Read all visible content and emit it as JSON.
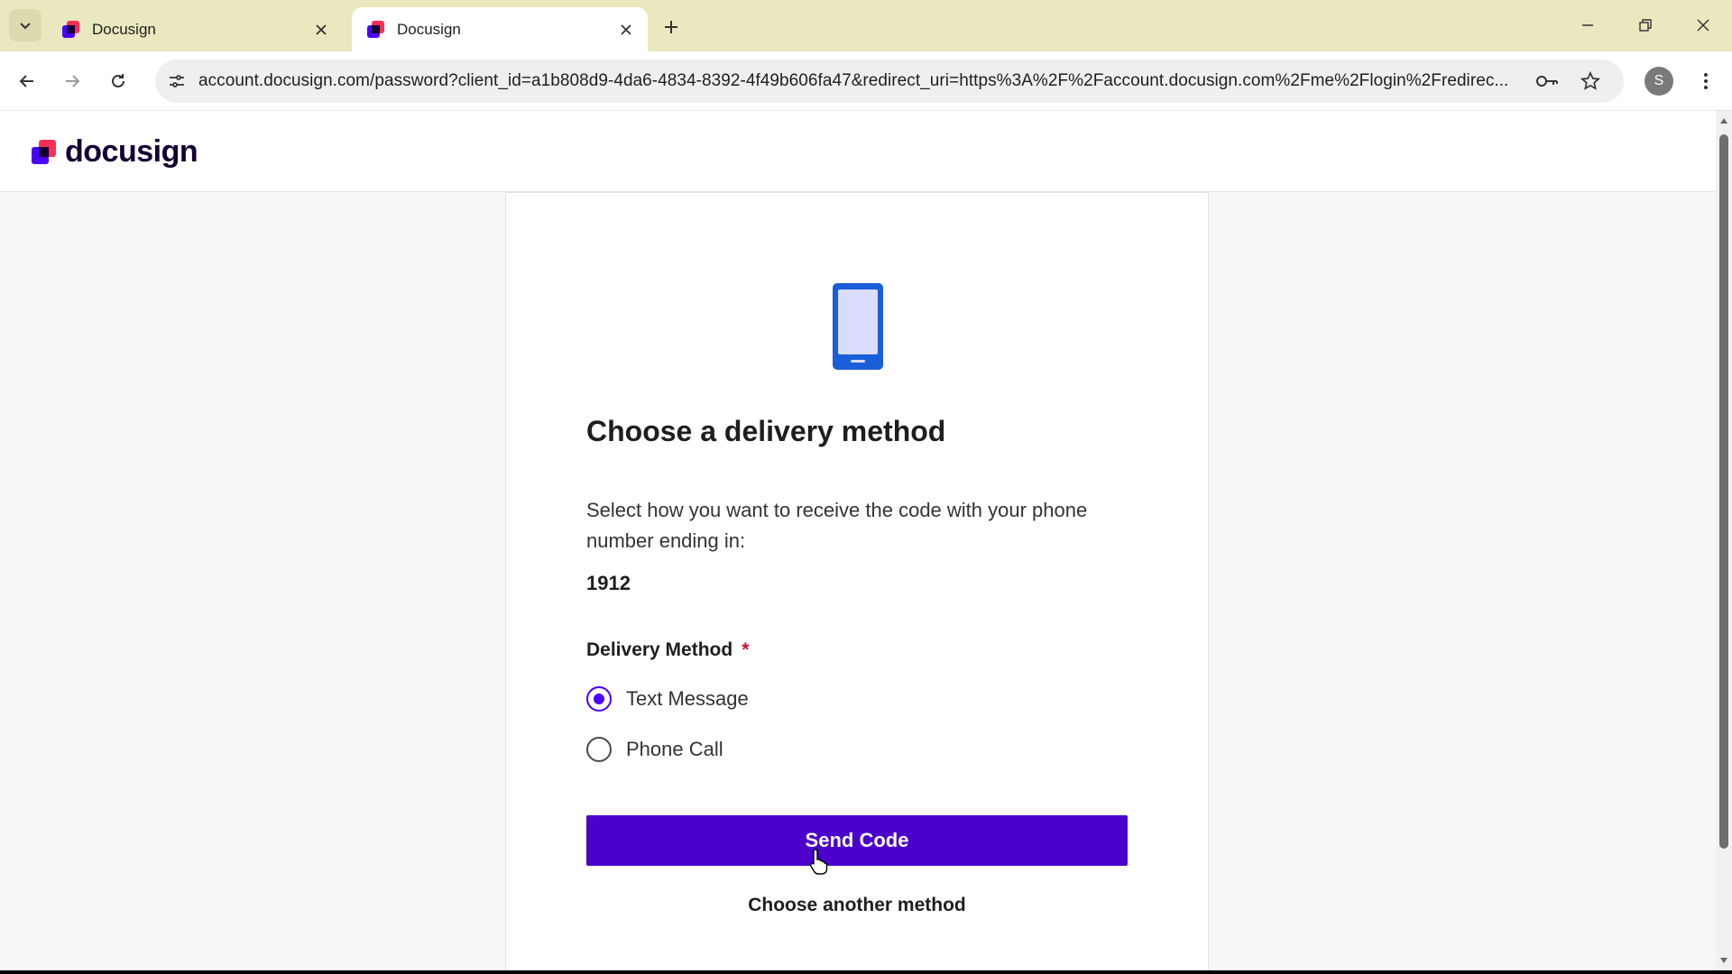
{
  "browser": {
    "tabs": [
      {
        "title": "Docusign",
        "active": false
      },
      {
        "title": "Docusign",
        "active": true
      }
    ],
    "url": "account.docusign.com/password?client_id=a1b808d9-4da6-4834-8392-4f49b606fa47&redirect_uri=https%3A%2F%2Faccount.docusign.com%2Fme%2Flogin%2Fredirec...",
    "profile_initial": "S"
  },
  "site": {
    "logo_text": "docusign"
  },
  "card": {
    "icon": "mobile-phone-icon",
    "heading": "Choose a delivery method",
    "description": "Select how you want to receive the code with your phone number ending in:",
    "phone_last_digits": "1912",
    "field_label": "Delivery Method",
    "required_mark": "*",
    "options": [
      {
        "label": "Text Message",
        "selected": true
      },
      {
        "label": "Phone Call",
        "selected": false
      }
    ],
    "submit_label": "Send Code",
    "alt_link": "Choose another method"
  },
  "colors": {
    "accent": "#4c00ff",
    "button": "#4c00cc",
    "tabstrip": "#e9e8bf",
    "phone_icon": "#1a5ed9"
  }
}
